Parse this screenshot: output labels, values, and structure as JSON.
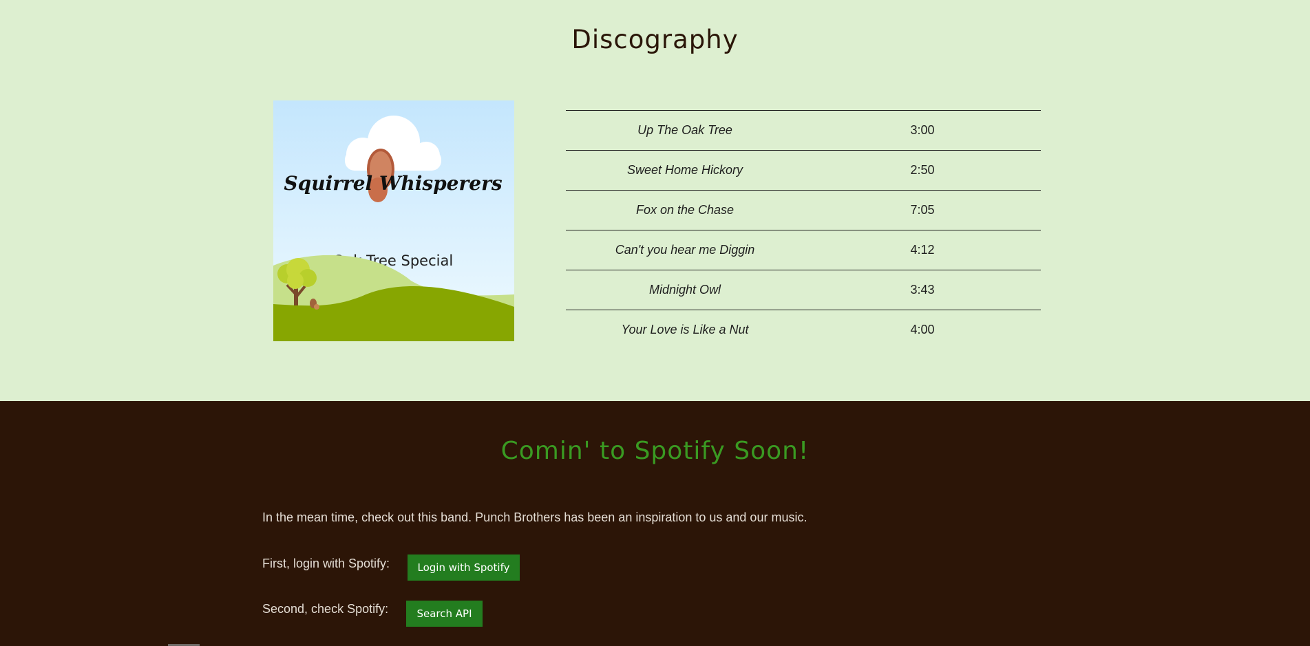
{
  "discography": {
    "title": "Discography",
    "album": {
      "band_name": "Squirrel Whisperers",
      "album_name": "Oak Tree Special"
    },
    "tracks": [
      {
        "name": "Up The Oak Tree",
        "duration": "3:00"
      },
      {
        "name": "Sweet Home Hickory",
        "duration": "2:50"
      },
      {
        "name": "Fox on the Chase",
        "duration": "7:05"
      },
      {
        "name": "Can't you hear me Diggin",
        "duration": "4:12"
      },
      {
        "name": "Midnight Owl",
        "duration": "3:43"
      },
      {
        "name": "Your Love is Like a Nut",
        "duration": "4:00"
      }
    ]
  },
  "spotify": {
    "title": "Comin' to Spotify Soon!",
    "intro": "In the mean time, check out this band. Punch Brothers has been an inspiration to us and our music.",
    "login_label": "First, login with Spotify:",
    "login_button": "Login with Spotify",
    "search_label": "Second, check Spotify:",
    "search_button": "Search API"
  },
  "colors": {
    "discography_bg": "#ddefd0",
    "spotify_bg": "#2c1507",
    "spotify_title": "#3a9a22",
    "button_bg": "#237d1f"
  }
}
